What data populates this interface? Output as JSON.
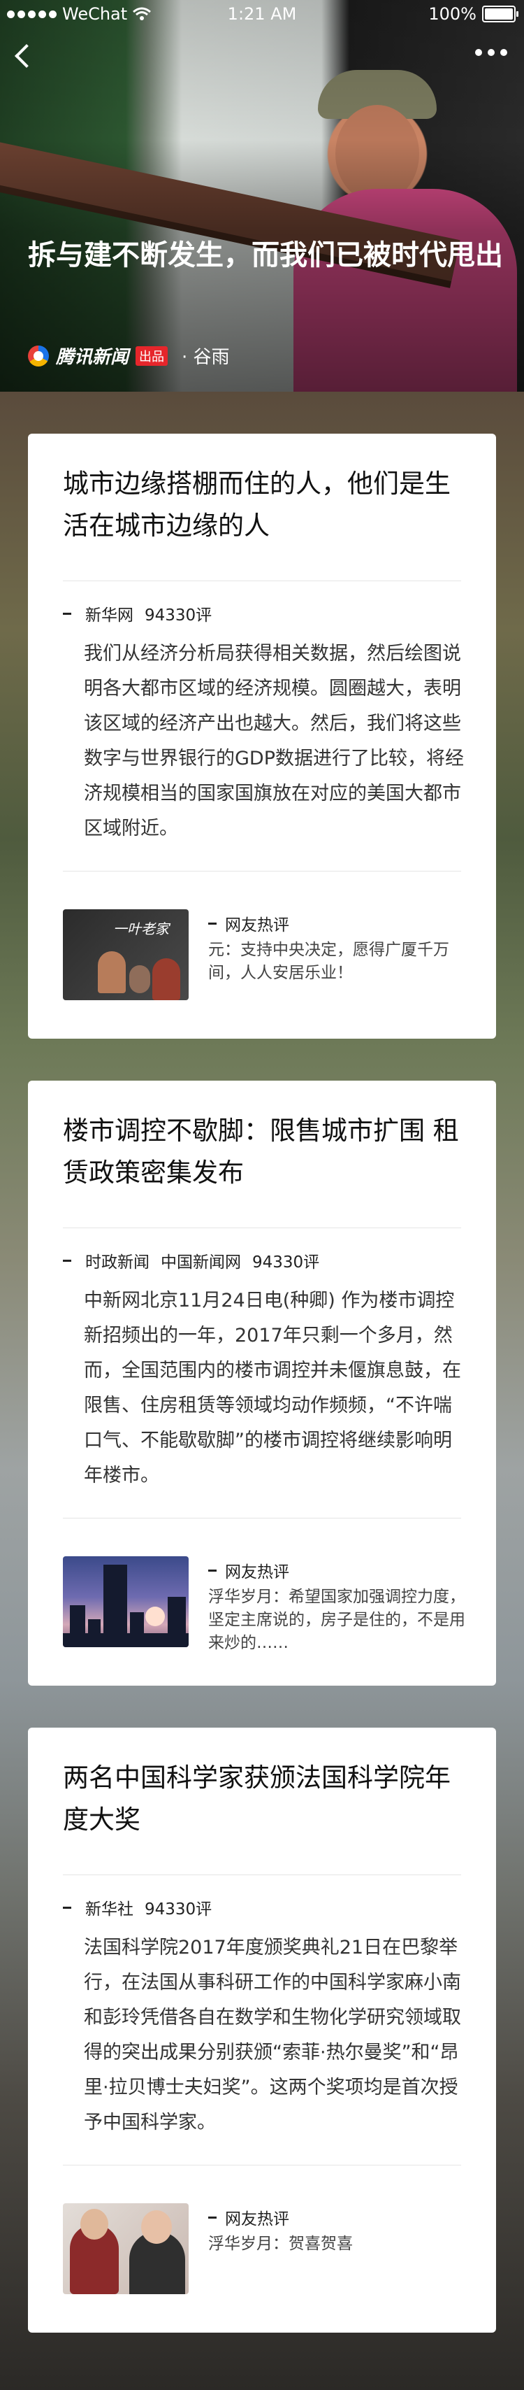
{
  "status_bar": {
    "carrier": "WeChat",
    "time": "1:21 AM",
    "battery": "100%"
  },
  "hero": {
    "title": "拆与建不断发生，而我们已被时代甩出",
    "brand": "腾讯新闻",
    "brand_tag": "出品",
    "author": "· 谷雨"
  },
  "cards": [
    {
      "title": "城市边缘搭棚而住的人，他们是生活在城市边缘的人",
      "sources": [
        "新华网",
        "94330评"
      ],
      "body": "我们从经济分析局获得相关数据，然后绘图说明各大都市区域的经济规模。圆圈越大，表明该区域的经济产出也越大。然后，我们将这些数字与世界银行的GDP数据进行了比较，将经济规模相当的国家国旗放在对应的美国大都市区域附近。",
      "hot_label": "网友热评",
      "hot_comment": "元：支持中央决定，愿得广厦千万间，人人安居乐业！",
      "thumb_text": "一叶老家"
    },
    {
      "title": "楼市调控不歇脚：限售城市扩围 租赁政策密集发布",
      "sources": [
        "时政新闻",
        "中国新闻网",
        "94330评"
      ],
      "body": "中新网北京11月24日电(种卿) 作为楼市调控新招频出的一年，2017年只剩一个多月，然而，全国范围内的楼市调控并未偃旗息鼓，在限售、住房租赁等领域均动作频频，“不许喘口气、不能歇歇脚”的楼市调控将继续影响明年楼市。",
      "hot_label": "网友热评",
      "hot_comment": "浮华岁月：希望国家加强调控力度，坚定主席说的，房子是住的，不是用来炒的……"
    },
    {
      "title": "两名中国科学家获颁法国科学院年度大奖",
      "sources": [
        "新华社",
        "94330评"
      ],
      "body": "法国科学院2017年度颁奖典礼21日在巴黎举行，在法国从事科研工作的中国科学家麻小南和彭玲凭借各自在数学和生物化学研究领域取得的突出成果分别获颁“索菲·热尔曼奖”和“昂里·拉贝博士夫妇奖”。这两个奖项均是首次授予中国科学家。",
      "hot_label": "网友热评",
      "hot_comment": "浮华岁月：贺喜贺喜"
    }
  ]
}
